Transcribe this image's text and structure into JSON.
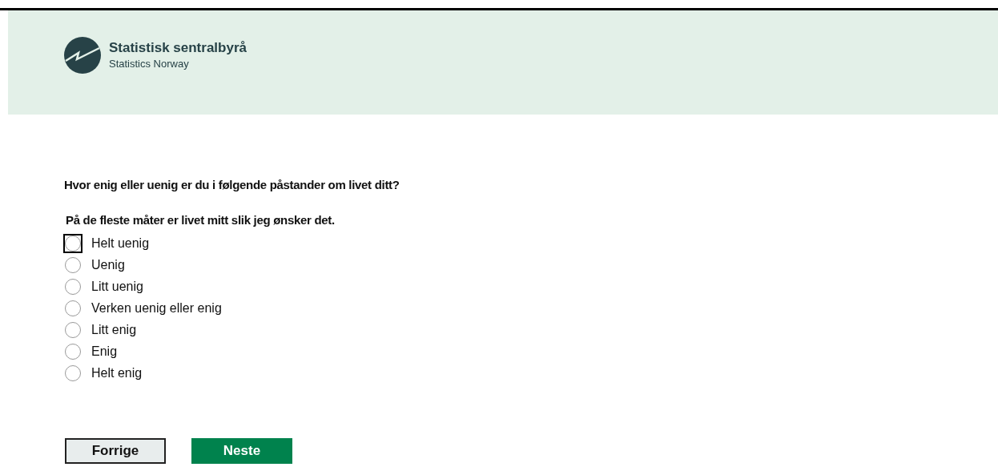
{
  "header": {
    "org_name": "Statistisk sentralbyrå",
    "org_subtitle": "Statistics Norway"
  },
  "question": "Hvor enig eller uenig er du i følgende påstander om livet ditt?",
  "statement": "På de fleste måter er livet mitt slik jeg ønsker det.",
  "options": [
    {
      "label": "Helt uenig",
      "selected": false,
      "focused": true
    },
    {
      "label": "Uenig",
      "selected": false,
      "focused": false
    },
    {
      "label": "Litt uenig",
      "selected": false,
      "focused": false
    },
    {
      "label": "Verken uenig eller enig",
      "selected": false,
      "focused": false
    },
    {
      "label": "Litt enig",
      "selected": false,
      "focused": false
    },
    {
      "label": "Enig",
      "selected": false,
      "focused": false
    },
    {
      "label": "Helt enig",
      "selected": false,
      "focused": false
    }
  ],
  "buttons": {
    "previous": "Forrige",
    "next": "Neste"
  }
}
